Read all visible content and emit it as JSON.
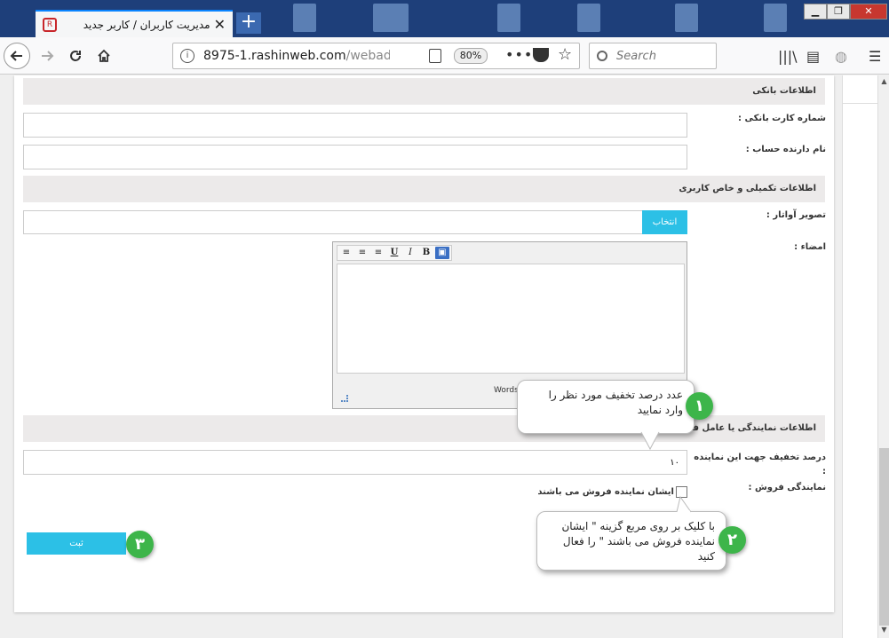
{
  "browser": {
    "tab_title": "مدیریت کاربران / کاربر جدید",
    "tab_close": "✕",
    "new_tab": "+",
    "url_main": "8975-1.rashinweb.com",
    "url_path": "/webadmin/",
    "zoom": "80%",
    "search_placeholder": "Search",
    "more": "•••",
    "win_min": "▁",
    "win_max": "❐",
    "win_close": "✕"
  },
  "bank_section": {
    "title": "اطلاعات بانکی",
    "card_label": "شماره کارت بانکی :",
    "card_value": "",
    "holder_label": "نام دارنده حساب :",
    "holder_value": ""
  },
  "extra_section": {
    "title": "اطلاعات تکمیلی و خاص کاربری",
    "avatar_label": "تصویر آواتار :",
    "avatar_button": "انتخاب",
    "signature_label": "امضاء :",
    "editor_words": "Words"
  },
  "agent_section": {
    "title": "اطلاعات نمایندگی یا عامل فروش",
    "discount_label": "درصد تخفیف جهت این نماینده :",
    "discount_value": "۱۰",
    "agency_label": "نمایندگی فروش :",
    "agency_checkbox_label": "ایشان نماینده فروش می باشند",
    "agency_checked": false
  },
  "submit_button": "ثبت",
  "callouts": [
    {
      "number": "۱",
      "text": "عدد درصد تخفیف مورد نظر را وارد نمایید"
    },
    {
      "number": "۲",
      "text": "با کلیک بر روی مربع گزینه \" ایشان نماینده فروش می باشند \" را فعال کنید"
    },
    {
      "number": "۳"
    }
  ]
}
